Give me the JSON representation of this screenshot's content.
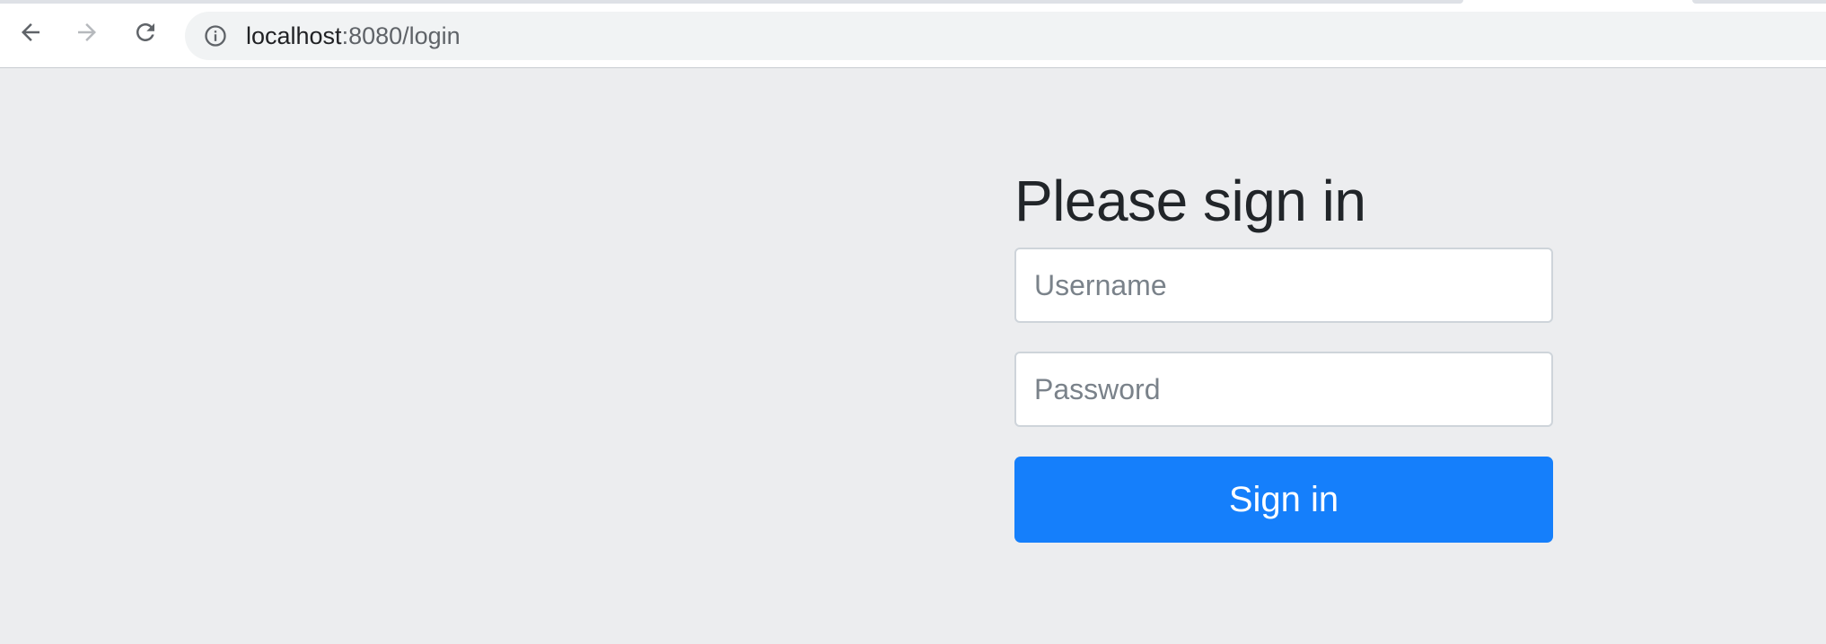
{
  "browser": {
    "url_host": "localhost",
    "url_path": ":8080/login",
    "icons": {
      "back": "arrow-left-icon",
      "forward": "arrow-right-icon",
      "reload": "reload-icon",
      "site_info": "info-icon"
    },
    "forward_enabled": false
  },
  "login": {
    "heading": "Please sign in",
    "username_placeholder": "Username",
    "username_value": "",
    "password_placeholder": "Password",
    "password_value": "",
    "submit_label": "Sign in"
  },
  "colors": {
    "page_background": "#ecedef",
    "primary_button": "#157ffb",
    "heading_text": "#212529"
  }
}
